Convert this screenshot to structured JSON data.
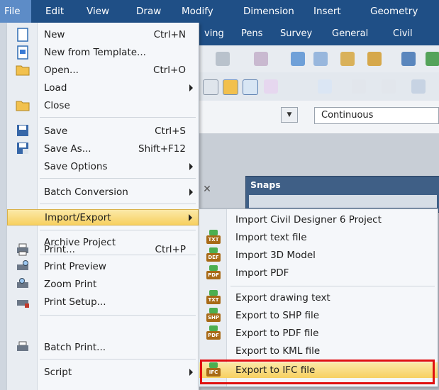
{
  "menubar": {
    "items": [
      {
        "label": "File",
        "active": true
      },
      {
        "label": "Edit"
      },
      {
        "label": "View"
      },
      {
        "label": "Draw"
      },
      {
        "label": "Modify"
      },
      {
        "label": "Dimension"
      },
      {
        "label": "Insert"
      },
      {
        "label": "Geometry"
      }
    ]
  },
  "toolbar2": {
    "items": [
      "ving",
      "Pens",
      "Survey",
      "General",
      "Civil"
    ]
  },
  "props": {
    "linetype": "Continuous"
  },
  "snaps": {
    "title": "Snaps"
  },
  "file_menu": {
    "items": [
      {
        "label": "New",
        "shortcut": "Ctrl+N",
        "icon": "new-document-icon"
      },
      {
        "label": "New from Template...",
        "shortcut": "",
        "icon": "template-icon"
      },
      {
        "label": "Open...",
        "shortcut": "Ctrl+O",
        "icon": "open-folder-icon"
      },
      {
        "label": "Load",
        "shortcut": "",
        "submenu": true
      },
      {
        "label": "Close",
        "shortcut": "",
        "icon": "close-folder-icon"
      },
      {
        "label": "Save",
        "shortcut": "Ctrl+S",
        "icon": "save-icon"
      },
      {
        "label": "Save As...",
        "shortcut": "Shift+F12",
        "icon": "save-as-icon"
      },
      {
        "label": "Save Options",
        "shortcut": "",
        "submenu": true
      },
      {
        "label": "Batch Conversion",
        "shortcut": "",
        "submenu": true
      },
      {
        "label": "Import/Export",
        "shortcut": "",
        "submenu": true,
        "highlighted": true
      },
      {
        "label": "Archive Project",
        "shortcut": ""
      },
      {
        "label": "Print...",
        "shortcut": "Ctrl+P",
        "icon": "printer-icon"
      },
      {
        "label": "Print Preview",
        "shortcut": "",
        "icon": "print-preview-icon"
      },
      {
        "label": "Zoom Print",
        "shortcut": "",
        "icon": "zoom-print-icon"
      },
      {
        "label": "Print Setup...",
        "shortcut": "",
        "icon": "print-setup-icon"
      },
      {
        "label": "Batch Print...",
        "shortcut": "",
        "icon": "batch-print-icon"
      },
      {
        "label": "Script",
        "shortcut": "",
        "submenu": true
      }
    ]
  },
  "submenu": {
    "items": [
      {
        "label": "Import Civil Designer 6 Project",
        "icon_text": ""
      },
      {
        "label": "Import text file",
        "icon_text": "TXT"
      },
      {
        "label": "Import 3D Model",
        "icon_text": "DEF"
      },
      {
        "label": "Import PDF",
        "icon_text": "PDF"
      },
      {
        "label": "Export drawing text",
        "icon_text": "TXT"
      },
      {
        "label": "Export to SHP file",
        "icon_text": "SHP"
      },
      {
        "label": "Export to PDF file",
        "icon_text": "PDF"
      },
      {
        "label": "Export to KML file",
        "icon_text": ""
      },
      {
        "label": "Export to IFC file",
        "icon_text": "IFC",
        "highlighted": true
      }
    ]
  },
  "colors": {
    "menubar": "#1f4f86",
    "highlight": "#f7d060",
    "callout": "#e01010"
  }
}
